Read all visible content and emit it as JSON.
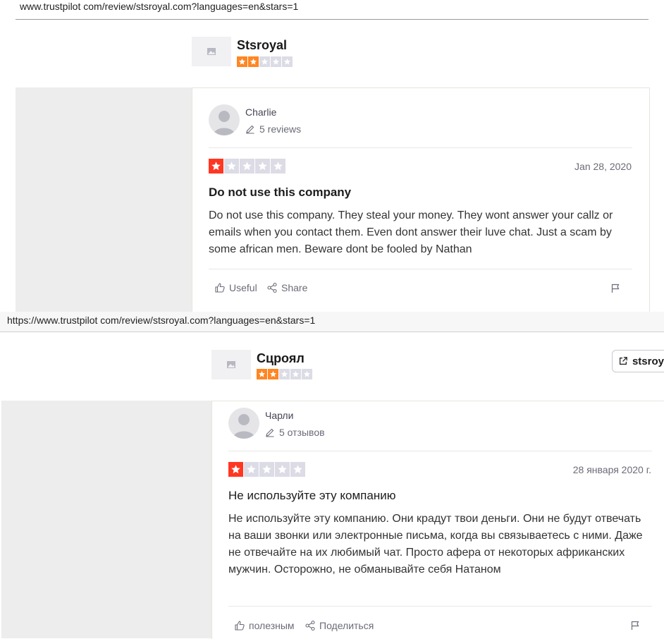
{
  "top": {
    "url": "www.trustpilot com/review/stsroyal.com?languages=en&stars=1",
    "company": "Stsroyal",
    "company_rating_stars": 2,
    "review": {
      "author": "Charlie",
      "review_count": "5 reviews",
      "rating_stars": 1,
      "date": "Jan 28, 2020",
      "title": "Do not use this company",
      "body": "Do not use this company. They steal your money. They wont answer your callz or emails when you contact them. Even dont answer their luve chat. Just a scam by some african men. Beware dont be fooled by Nathan",
      "useful_label": "Useful",
      "share_label": "Share"
    }
  },
  "bottom": {
    "url": "https://www.trustpilot com/review/stsroyal.com?languages=en&stars=1",
    "company": "Сцроял",
    "company_rating_stars": 2,
    "visit_label": "stsroy",
    "review": {
      "author": "Чарли",
      "review_count": "5 отзывов",
      "rating_stars": 1,
      "date": "28 января 2020 г.",
      "title": "Не используйте эту компанию",
      "body": "Не используйте эту компанию. Они крадут твои деньги. Они не будут отвечать на ваши звонки или электронные письма, когда вы связываетесь с ними. Даже не отвечайте на их любимый чат. Просто афера от некоторых африканских мужчин. Осторожно, не обманывайте себя Натаном",
      "useful_label": "полезным",
      "share_label": "Поделиться"
    }
  },
  "colors": {
    "star_orange": "#ff8622",
    "star_red": "#ff3722",
    "star_empty": "#dcdce6"
  },
  "icons": [
    "image-placeholder-icon",
    "star-icon",
    "pencil-icon",
    "thumbs-up-icon",
    "share-icon",
    "flag-icon",
    "external-link-icon",
    "avatar-icon"
  ]
}
